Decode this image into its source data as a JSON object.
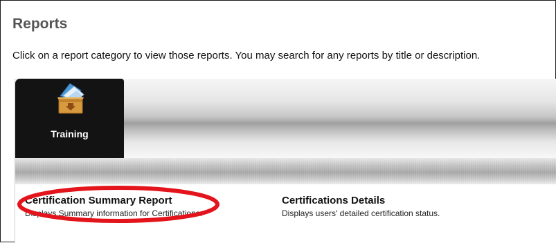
{
  "page": {
    "title": "Reports",
    "intro": "Click on a report category to view those reports. You may search for any reports by title or description."
  },
  "tabs": [
    {
      "label": "Training",
      "icon": "training-box-icon",
      "selected": true
    }
  ],
  "reports": [
    {
      "title": "Certification Summary Report",
      "description": "Displays Summary information for Certifications.",
      "highlighted": true
    },
    {
      "title": "Certifications Details",
      "description": "Displays users' detailed certification status."
    }
  ],
  "colors": {
    "title": "#555555",
    "tab_background": "#131313",
    "highlight": "#e3141b"
  }
}
